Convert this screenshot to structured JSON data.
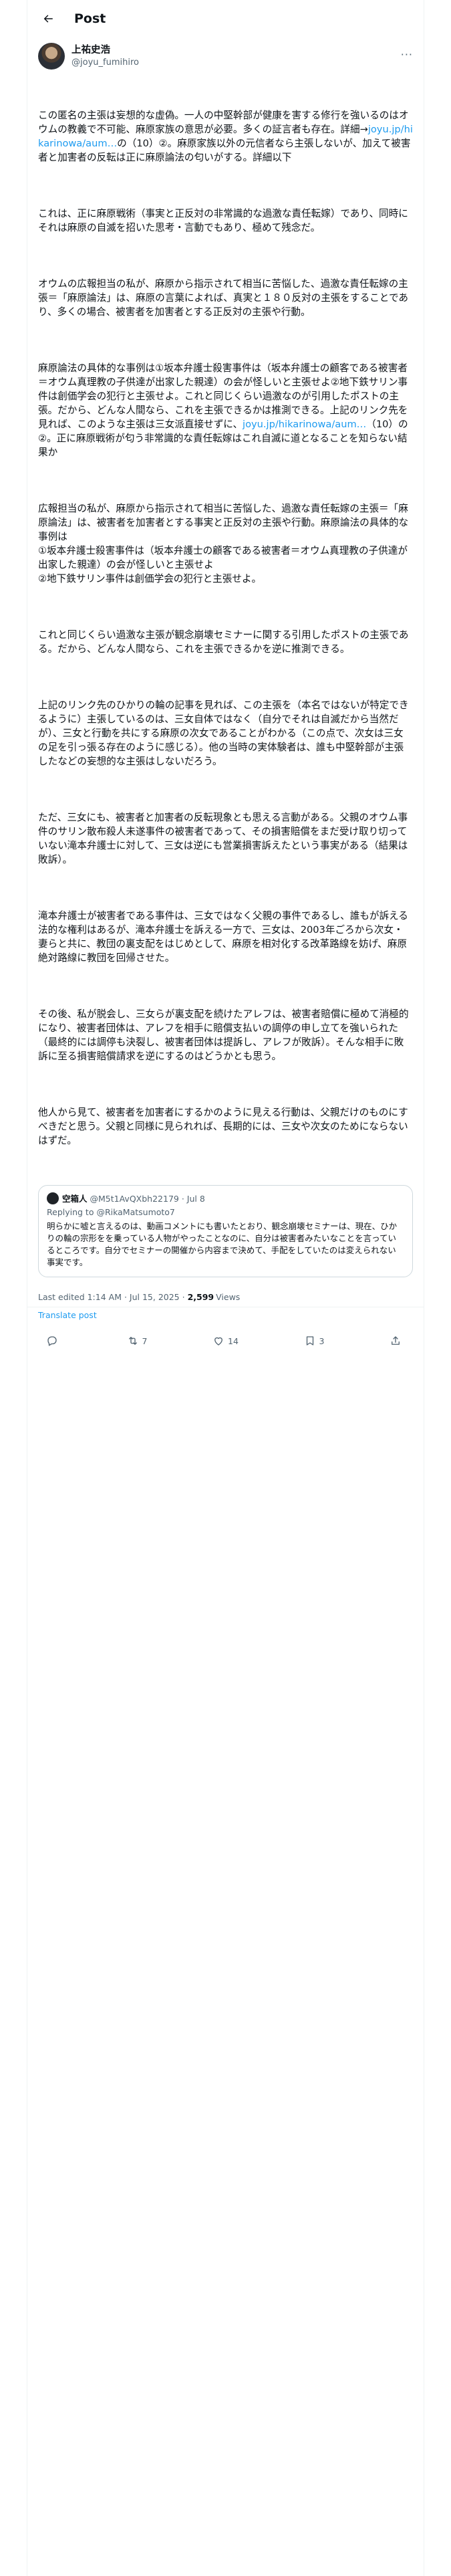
{
  "header": {
    "title": "Post"
  },
  "author": {
    "display_name": "上祐史浩",
    "handle": "@joyu_fumihiro"
  },
  "post": {
    "paragraphs": [
      "この匿名の主張は妄想的な虚偽。一人の中堅幹部が健康を害する修行を強いるのはオウムの教義で不可能、麻原家族の意思が必要。多くの証言者も存在。詳細→",
      "これは、正に麻原戦術（事実と正反対の非常識的な過激な責任転嫁）であり、同時にそれは麻原の自滅を招いた思考・言動でもあり、極めて残念だ。",
      "オウムの広報担当の私が、麻原から指示されて相当に苦悩した、過激な責任転嫁の主張＝「麻原論法」は、麻原の言葉によれば、真実と１８０反対の主張をすることであり、多くの場合、被害者を加害者とする正反対の主張や行動。",
      "麻原論法の具体的な事例は①坂本弁護士殺害事件は（坂本弁護士の顧客である被害者＝オウム真理教の子供達が出家した親達）の会が怪しいと主張せよ②地下鉄サリン事件は創価学会の犯行と主張せよ。これと同じくらい過激なのが引用したポストの主張。だから、どんな人間なら、これを主張できるかは推測できる。上記のリンク先を見れば、このような主張は三女派直接せずに、",
      "広報担当の私が、麻原から指示されて相当に苦悩した、過激な責任転嫁の主張＝「麻原論法」は、被害者を加害者とする事実と正反対の主張や行動。麻原論法の具体的な事例は\n①坂本弁護士殺害事件は（坂本弁護士の顧客である被害者＝オウム真理教の子供達が出家した親達）の会が怪しいと主張せよ\n②地下鉄サリン事件は創価学会の犯行と主張せよ。",
      "これと同じくらい過激な主張が観念崩壊セミナーに関する引用したポストの主張である。だから、どんな人間なら、これを主張できるかを逆に推測できる。",
      "上記のリンク先のひかりの輪の記事を見れば、この主張を（本名ではないが特定できるように）主張しているのは、三女自体ではなく（自分でそれは自滅だから当然だが）、三女と行動を共にする麻原の次女であることがわかる（この点で、次女は三女の足を引っ張る存在のように感じる）。他の当時の実体験者は、誰も中堅幹部が主張したなどの妄想的な主張はしないだろう。",
      "ただ、三女にも、被害者と加害者の反転現象とも思える言動がある。父親のオウム事件のサリン散布殺人未遂事件の被害者であって、その損害賠償をまだ受け取り切っていない滝本弁護士に対して、三女は逆にも営業損害訴えたという事実がある（結果は敗訴）。",
      "滝本弁護士が被害者である事件は、三女ではなく父親の事件であるし、誰もが訴える法的な権利はあるが、滝本弁護士を訴える一方で、三女は、2003年ごろから次女・妻らと共に、教団の裏支配をはじめとして、麻原を相対化する改革路線を妨げ、麻原絶対路線に教団を回帰させた。",
      "その後、私が脱会し、三女らが裏支配を続けたアレフは、被害者賠償に極めて消極的になり、被害者団体は、アレフを相手に賠償支払いの調停の申し立てを強いられた（最終的には調停も決裂し、被害者団体は提訴し、アレフが敗訴）。そんな相手に敗訴に至る損害賠償請求を逆にするのはどうかとも思う。",
      "他人から見て、被害者を加害者にするかのように見える行動は、父親だけのものにすべきだと思う。父親と同様に見られれば、長期的には、三女や次女のためにならないはずだ。"
    ],
    "link_1": "joyu.jp/hikarinowa/aum…",
    "link_1_suffix": "の（10）②。麻原家族以外の元信者なら主張しないが、加えて被害者と加害者の反転は正に麻原論法の匂いがする。詳細以下",
    "link_2": "joyu.jp/hikarinowa/aum…",
    "link_2_suffix": "（10）の②。正に麻原戦術が匂う非常識的な責任転嫁はこれ自滅に道となることを知らない結果か"
  },
  "quote": {
    "name": "空箱人",
    "handle": "@M5t1AvQXbh22179",
    "date": "Jul 8",
    "reply_label": "Replying to @RikaMatsumoto7",
    "text": "明らかに嘘と言えるのは、動画コメントにも書いたとおり、観念崩壊セミナーは、現在、ひかりの輪の宗形をを乗っている人物がやったことなのに、自分は被害者みたいなことを言っているところです。自分でセミナーの開催から内容まで決めて、手配をしていたのは変えられない事実です。"
  },
  "meta": {
    "timestamp": "Last edited 1:14 AM · Jul 15, 2025 ·",
    "views_count": "2,599",
    "views_label": "Views",
    "translate": "Translate post"
  },
  "actions": {
    "reply_count": "",
    "repost_count": "7",
    "like_count": "14",
    "bookmark_count": "3"
  },
  "colors": {
    "accent": "#1d9bf0",
    "text": "#0f1419",
    "muted": "#536471",
    "border": "#eff3f4"
  }
}
